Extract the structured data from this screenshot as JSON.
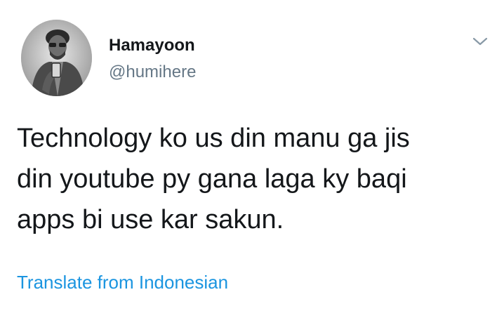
{
  "tweet": {
    "author": {
      "display_name": "Hamayoon",
      "handle": "@humihere",
      "avatar_icon": "user-avatar-photo"
    },
    "menu_icon": "chevron-down-icon",
    "text": "Technology ko us din manu ga jis\ndin youtube py gana laga ky baqi\napps bi use kar sakun.",
    "translate_link": "Translate from Indonesian"
  },
  "colors": {
    "text": "#14171a",
    "secondary": "#657786",
    "link": "#1b95e0",
    "chevron": "#8899a6"
  }
}
